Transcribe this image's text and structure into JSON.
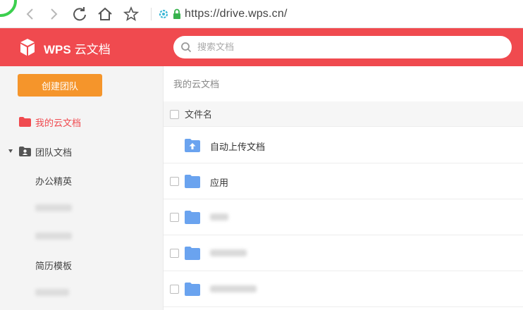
{
  "browser": {
    "url": "https://drive.wps.cn/"
  },
  "header": {
    "brand_bold": "WPS",
    "brand_rest": "云文档",
    "search_placeholder": "搜索文档",
    "color": "#f04a4f"
  },
  "sidebar": {
    "create_button": "创建团队",
    "my_docs": "我的云文档",
    "team_docs": "团队文档",
    "team_items": [
      "办公精英",
      "简历模板"
    ]
  },
  "main": {
    "breadcrumb": "我的云文档",
    "column_name": "文件名",
    "rows": [
      "自动上传文档",
      "应用"
    ]
  },
  "colors": {
    "accent": "#f04a4f",
    "create_button": "#f5952b",
    "folder": "#6aa3ef"
  }
}
